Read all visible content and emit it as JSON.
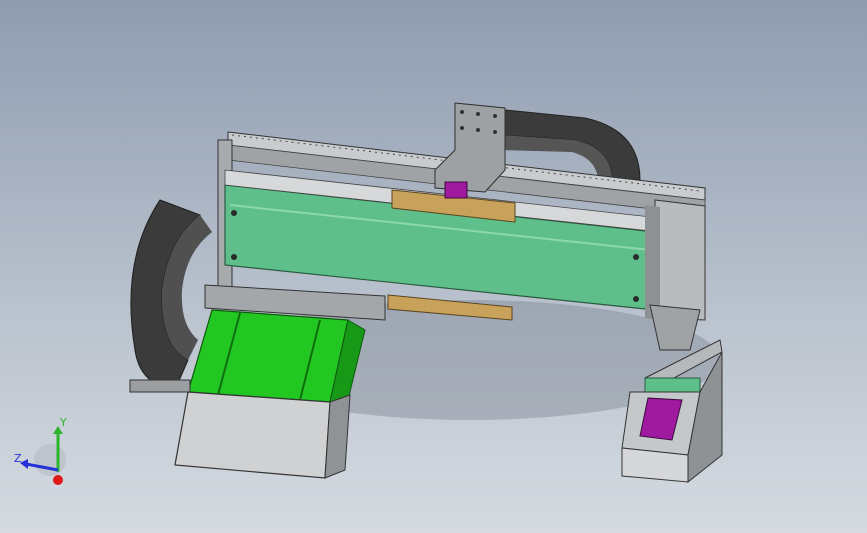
{
  "viewport": {
    "background_top": "#8f9cb0",
    "background_bottom": "#d6dbe1"
  },
  "triad": {
    "y_label": "Y",
    "z_label": "Z",
    "y_color": "#2db52d",
    "z_color": "#2430d8",
    "x_color": "#e01818"
  },
  "colors": {
    "frame_grey": "#b4b7ba",
    "green_cover": "#5fbf8a",
    "bright_green": "#22c722",
    "magenta": "#a01aa0",
    "brass": "#c8a25a",
    "cable_dark": "#3b3b3b"
  }
}
